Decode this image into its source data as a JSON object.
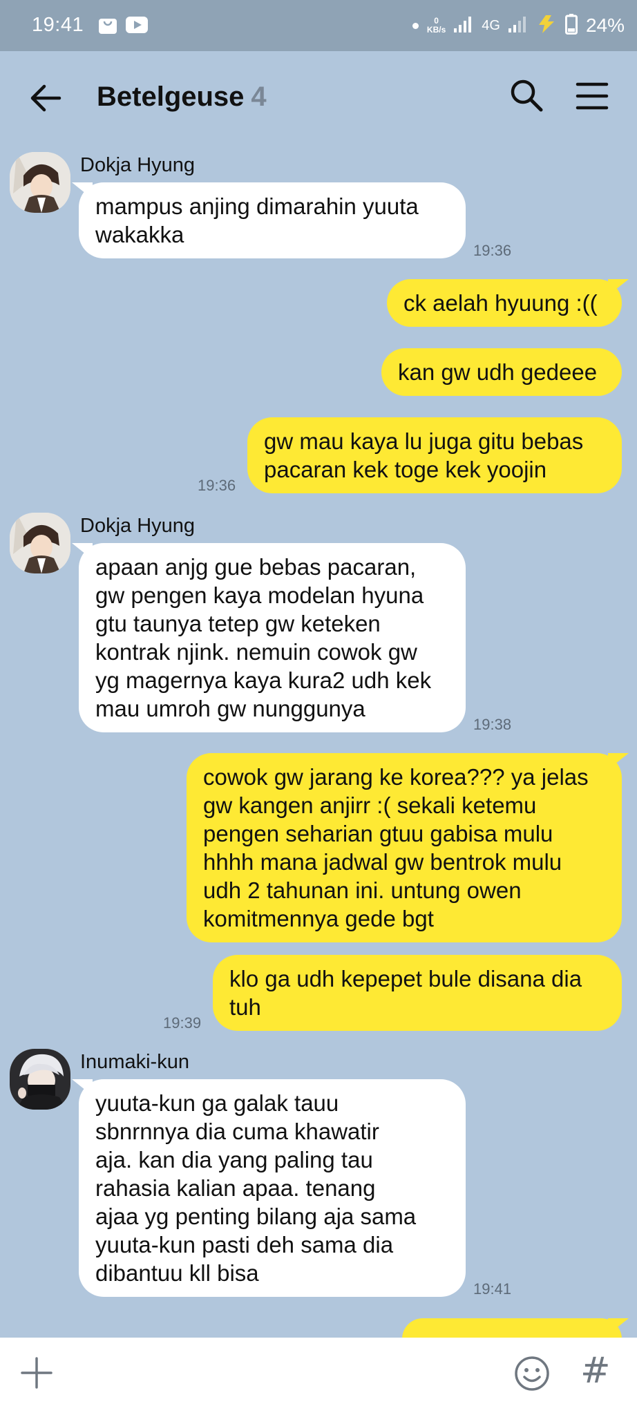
{
  "status_bar": {
    "time": "19:41",
    "net_speed_value": "0",
    "net_speed_unit": "KB/s",
    "network": "4G",
    "battery": "24%"
  },
  "header": {
    "title": "Betelgeuse",
    "member_count": "4"
  },
  "messages": [
    {
      "sender": "Dokja Hyung",
      "lines": [
        "mampus anjing dimarahin yuuta",
        "wakakka"
      ],
      "time": "19:36"
    },
    {
      "lines": [
        "ck aelah hyuung :(("
      ]
    },
    {
      "lines": [
        "kan gw udh gedeee"
      ]
    },
    {
      "lines": [
        "gw mau kaya lu juga gitu bebas",
        "pacaran kek toge kek yoojin"
      ],
      "time": "19:36"
    },
    {
      "sender": "Dokja Hyung",
      "lines": [
        "apaan anjg gue bebas pacaran,",
        "gw pengen kaya modelan hyuna",
        "gtu taunya tetep gw keteken",
        "kontrak njink. nemuin cowok gw",
        "yg magernya kaya kura2 udh kek",
        "mau umroh gw nunggunya"
      ],
      "time": "19:38"
    },
    {
      "lines": [
        "cowok gw jarang ke korea??? ya jelas",
        "gw kangen anjirr :( sekali ketemu",
        "pengen seharian gtuu gabisa mulu",
        "hhhh mana jadwal gw bentrok mulu",
        "udh 2 tahunan ini. untung owen",
        "komitmennya gede bgt"
      ]
    },
    {
      "lines": [
        "klo ga udh kepepet bule disana dia",
        "tuh"
      ],
      "time": "19:39"
    },
    {
      "sender": "Inumaki-kun",
      "lines": [
        "yuuta-kun ga galak tauu",
        "sbnrnnya dia cuma khawatir",
        "aja. kan dia yang paling tau",
        "rahasia kalian apaa. tenang",
        "ajaa yg penting bilang aja sama",
        "yuuta-kun pasti deh sama dia",
        "dibantuu kll bisa"
      ],
      "time": "19:41"
    }
  ],
  "icons": {
    "back": "arrow-left-icon",
    "search": "search-icon",
    "menu": "hamburger-menu-icon",
    "plus": "plus-icon",
    "emoji": "smiley-icon",
    "hash": "#"
  },
  "colors": {
    "chat_background": "#b1c6dc",
    "outgoing_bubble": "#fee934",
    "incoming_bubble": "#ffffff",
    "status_bar": "#8fa3b5"
  }
}
